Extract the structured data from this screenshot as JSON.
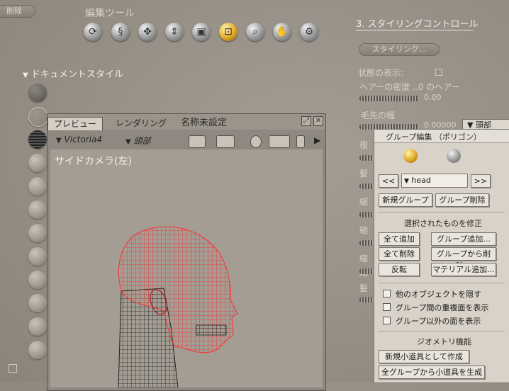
{
  "top": {
    "delete_label": "削除",
    "tools_title": "編集ツール"
  },
  "styling": {
    "title": "3. スタイリングコントロール",
    "styling_button": "スタイリング...",
    "state_label": "状態の表示:",
    "hair_density_label": "ヘアーの密度 ..0 のヘアー",
    "hair_density_value": "0.00",
    "tip_width_label": "毛先の幅",
    "tip_width_value": "0.00000",
    "tip_width_dropdown": "頭部",
    "clipped_labels": [
      "根",
      "髪",
      "縮",
      "縮",
      "縮",
      "縮",
      "髪"
    ]
  },
  "document_style": {
    "title": "ドキュメントスタイル"
  },
  "preview": {
    "tabs": [
      "プレビュー",
      "レンダリング"
    ],
    "title": "名称未設定",
    "figure_select": "Victoria4",
    "part_select": "頭部",
    "camera_label": "サイドカメラ(左)"
  },
  "group_editor": {
    "title": "グループ編集 （ポリゴン）",
    "prev_label": "<<",
    "next_label": ">>",
    "group_select": "head",
    "new_group": "新規グループ",
    "delete_group": "グループ削除",
    "modify_heading": "選択されたものを修正",
    "add_all": "全て追加",
    "add_group": "グループ追加...",
    "remove_all": "全て削除",
    "remove_from_group": "グループから削除...",
    "invert": "反転",
    "add_material": "マテリアル追加...",
    "options": [
      "他のオブジェクトを隠す",
      "グループ間の重複面を表示",
      "グループ以外の面を表示"
    ],
    "geometry_heading": "ジオメトリ機能",
    "create_prop": "新規小道具として作成",
    "create_all_props": "全グループから小道具を生成"
  }
}
